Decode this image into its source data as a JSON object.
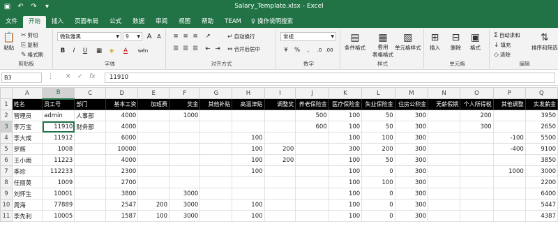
{
  "title_bar": {
    "title": "Salary_Template.xlsx  -  Excel",
    "qat_icons": [
      "save-icon",
      "undo-icon",
      "redo-icon",
      "customize-icon"
    ]
  },
  "tabs": [
    {
      "label": "文件"
    },
    {
      "label": "开始",
      "active": true
    },
    {
      "label": "插入"
    },
    {
      "label": "页面布局"
    },
    {
      "label": "公式"
    },
    {
      "label": "数据"
    },
    {
      "label": "审阅"
    },
    {
      "label": "视图"
    },
    {
      "label": "帮助"
    },
    {
      "label": "TEAM"
    }
  ],
  "tell_me": "操作说明搜索",
  "ribbon": {
    "clipboard": {
      "paste": "粘贴",
      "cut": "剪切",
      "copy": "复制",
      "format_painter": "格式刷",
      "group": "剪贴板"
    },
    "font": {
      "name": "微软雅黑",
      "size": "9",
      "grow": "A",
      "shrink": "A",
      "bold": "B",
      "italic": "I",
      "underline": "U",
      "font_color": "A",
      "phonetic": "wén",
      "group": "字体"
    },
    "alignment": {
      "wrap": "自动换行",
      "merge": "合并后居中",
      "group": "对齐方式"
    },
    "number": {
      "format": "常规",
      "currency": "%",
      "comma": ",",
      "group": "数字"
    },
    "styles": {
      "conditional": "条件格式",
      "table_line1": "套用",
      "table_line2": "表格格式",
      "cell_styles": "单元格样式",
      "group": "样式"
    },
    "cells": {
      "insert": "插入",
      "delete": "删除",
      "format": "格式",
      "group": "单元格"
    },
    "editing": {
      "autosum": "自动求和",
      "fill": "填充",
      "clear": "清除",
      "sort": "排序和筛选",
      "group": "编辑"
    }
  },
  "formula_bar": {
    "name_box": "B3",
    "fx": "fx",
    "value": "11910"
  },
  "columns": [
    "A",
    "B",
    "C",
    "D",
    "E",
    "F",
    "G",
    "H",
    "I",
    "J",
    "K",
    "L",
    "M",
    "N",
    "O",
    "P",
    "Q"
  ],
  "selected_column": "B",
  "selected_row": 3,
  "headers": [
    "姓名",
    "员工号",
    "部门",
    "基本工资",
    "加班费",
    "奖金",
    "其他补贴",
    "高温津贴",
    "调整奖",
    "养老保险金",
    "医疗保险金",
    "失业保险金",
    "住房公积金",
    "无薪假期",
    "个人所得税",
    "其他调整",
    "实发薪金"
  ],
  "rows": [
    {
      "num": 2,
      "cells": [
        "管理员",
        "admin",
        "人事部",
        "4000",
        "",
        "1000",
        "",
        "",
        "",
        "500",
        "100",
        "50",
        "300",
        "",
        "200",
        "",
        "3950"
      ]
    },
    {
      "num": 3,
      "cells": [
        "李万宝",
        "11910",
        "财务部",
        "4000",
        "",
        "",
        "",
        "",
        "",
        "600",
        "100",
        "50",
        "300",
        "",
        "300",
        "",
        "2650"
      ]
    },
    {
      "num": 4,
      "cells": [
        "李大成",
        "11912",
        "",
        "6000",
        "",
        "",
        "",
        "100",
        "",
        "",
        "100",
        "100",
        "300",
        "",
        "",
        "-100",
        "5500"
      ]
    },
    {
      "num": 5,
      "cells": [
        "罗辉",
        "1008",
        "",
        "10000",
        "",
        "",
        "",
        "100",
        "200",
        "",
        "300",
        "200",
        "300",
        "",
        "",
        "-400",
        "9100"
      ]
    },
    {
      "num": 6,
      "cells": [
        "王小雨",
        "11223",
        "",
        "4000",
        "",
        "",
        "",
        "100",
        "200",
        "",
        "100",
        "50",
        "300",
        "",
        "",
        "",
        "3850"
      ]
    },
    {
      "num": 7,
      "cells": [
        "季珍",
        "112233",
        "",
        "2300",
        "",
        "",
        "",
        "100",
        "",
        "",
        "100",
        "0",
        "300",
        "",
        "",
        "1000",
        "3000"
      ]
    },
    {
      "num": 8,
      "cells": [
        "任丽英",
        "1009",
        "",
        "2700",
        "",
        "",
        "",
        "",
        "",
        "",
        "100",
        "100",
        "300",
        "",
        "",
        "",
        "2200"
      ]
    },
    {
      "num": 9,
      "cells": [
        "刘怀生",
        "10001",
        "",
        "3800",
        "",
        "3000",
        "",
        "",
        "",
        "",
        "100",
        "0",
        "300",
        "",
        "",
        "",
        "6400"
      ]
    },
    {
      "num": 10,
      "cells": [
        "周海",
        "77889",
        "",
        "2547",
        "200",
        "3000",
        "",
        "100",
        "",
        "",
        "100",
        "0",
        "300",
        "",
        "",
        "",
        "5447"
      ]
    },
    {
      "num": 11,
      "cells": [
        "李先利",
        "10005",
        "",
        "1587",
        "100",
        "3000",
        "",
        "100",
        "",
        "",
        "100",
        "0",
        "300",
        "",
        "",
        "",
        "4387"
      ]
    }
  ]
}
